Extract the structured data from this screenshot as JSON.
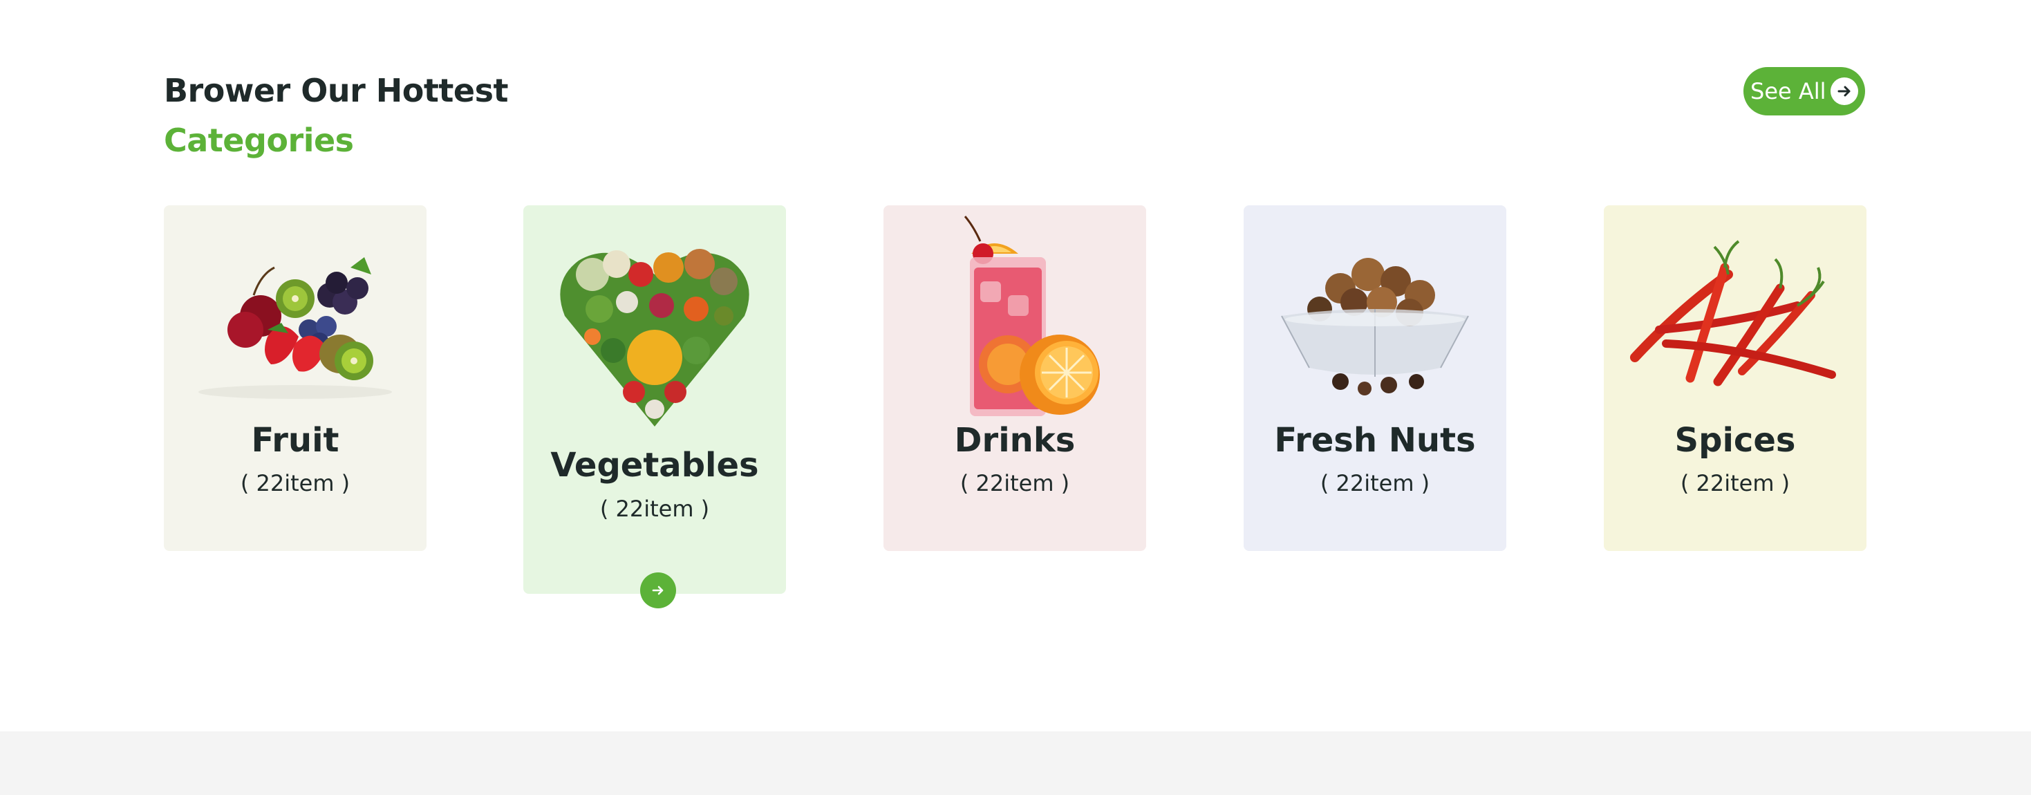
{
  "header": {
    "title_line1": "Brower Our Hottest",
    "title_line2": "Categories",
    "see_all_label": "See All"
  },
  "colors": {
    "accent": "#5cb238",
    "heading": "#1f2a2a",
    "footer_band": "#f4f4f4"
  },
  "categories": [
    {
      "name": "Fruit",
      "count": "( 22item )",
      "image_icon": "fruit-icon",
      "background": "#f4f4ec"
    },
    {
      "name": "Vegetables",
      "count": "( 22item )",
      "image_icon": "vegetables-icon",
      "background": "#e6f6e1",
      "active": true,
      "arrow_icon": "arrow-right-icon"
    },
    {
      "name": "Drinks",
      "count": "( 22item )",
      "image_icon": "drink-icon",
      "background": "#f6eaea"
    },
    {
      "name": "Fresh Nuts",
      "count": "( 22item )",
      "image_icon": "nuts-icon",
      "background": "#eceef7"
    },
    {
      "name": "Spices",
      "count": "( 22item )",
      "image_icon": "chili-icon",
      "background": "#f6f5dc"
    }
  ]
}
